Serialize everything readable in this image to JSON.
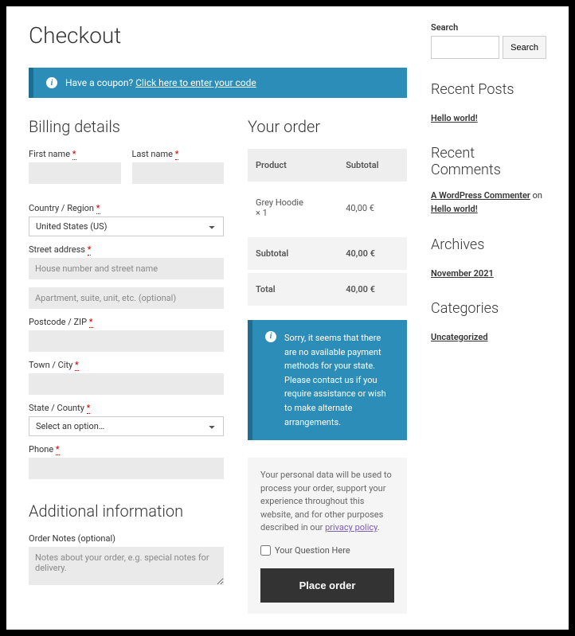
{
  "page": {
    "title": "Checkout"
  },
  "coupon": {
    "prompt": "Have a coupon?",
    "link": "Click here to enter your code"
  },
  "billing": {
    "heading": "Billing details",
    "first_name": "First name",
    "last_name": "Last name",
    "country": "Country / Region",
    "country_value": "United States (US)",
    "street": "Street address",
    "street_ph": "House number and street name",
    "street2_ph": "Apartment, suite, unit, etc. (optional)",
    "postcode": "Postcode / ZIP",
    "town": "Town / City",
    "state": "State / County",
    "state_ph": "Select an option…",
    "phone": "Phone"
  },
  "additional": {
    "heading": "Additional information",
    "notes_label": "Order Notes (optional)",
    "notes_ph": "Notes about your order, e.g. special notes for delivery."
  },
  "order": {
    "heading": "Your order",
    "product_h": "Product",
    "subtotal_h": "Subtotal",
    "item_name": "Grey Hoodie",
    "item_qty": "× 1",
    "item_total": "40,00 €",
    "subtotal_label": "Subtotal",
    "subtotal_value": "40,00 €",
    "total_label": "Total",
    "total_value": "40,00 €",
    "no_payment": "Sorry, it seems that there are no available payment methods for your state. Please contact us if you require assistance or wish to make alternate arrangements.",
    "privacy_text": "Your personal data will be used to process your order, support your experience throughout this website, and for other purposes described in our ",
    "privacy_link": "privacy policy",
    "question": "Your Question Here",
    "place_order": "Place order"
  },
  "sidebar": {
    "search_label": "Search",
    "search_btn": "Search",
    "recent_posts": "Recent Posts",
    "post1": "Hello world!",
    "recent_comments": "Recent Comments",
    "commenter": "A WordPress Commenter",
    "on": " on ",
    "comment_post": "Hello world!",
    "archives": "Archives",
    "archive1": "November 2021",
    "categories": "Categories",
    "cat1": "Uncategorized"
  }
}
